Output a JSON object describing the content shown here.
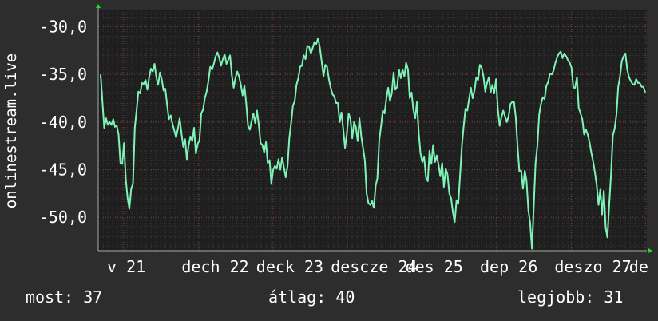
{
  "chart_data": {
    "type": "line",
    "ylabel": "onlinestream.live",
    "ylim": [
      -53.5,
      -28.2
    ],
    "y_ticks": [
      -30,
      -35,
      -40,
      -45,
      -50
    ],
    "y_tick_labels": [
      "-30,0",
      "-35,0",
      "-40,0",
      "-45,0",
      "-50,0"
    ],
    "x_tick_labels": [
      "v 21",
      "dech 22",
      "deck 23",
      "descze 24",
      "des 25",
      "dep 26",
      "deszo 27",
      "de"
    ],
    "grid": true,
    "colors": {
      "line": "#7ff3b7",
      "background": "#2d2d2d",
      "plot_bg": "#1e1e1e",
      "grid_minor": "#3a3a3a",
      "grid_major": "#7a3f3f",
      "axis_arrow": "#22dd22"
    },
    "series": [
      {
        "values": [
          -35.0,
          -37.9,
          -40.6,
          -39.6,
          -40.3,
          -40.0,
          -40.3,
          -39.7,
          -40.5,
          -40.4,
          -41.3,
          -44.3,
          -44.4,
          -42.2,
          -46.0,
          -48.0,
          -49.1,
          -47.0,
          -46.5,
          -40.6,
          -38.8,
          -36.8,
          -37.0,
          -35.9,
          -36.0,
          -35.6,
          -36.6,
          -35.3,
          -34.4,
          -34.7,
          -33.9,
          -35.3,
          -36.1,
          -34.8,
          -35.5,
          -36.7,
          -36.5,
          -38.2,
          -39.7,
          -39.3,
          -40.2,
          -40.9,
          -41.6,
          -40.7,
          -39.6,
          -41.2,
          -42.6,
          -41.8,
          -43.9,
          -42.4,
          -41.5,
          -42.0,
          -40.6,
          -43.3,
          -42.3,
          -41.9,
          -39.1,
          -38.7,
          -37.5,
          -36.8,
          -35.7,
          -34.2,
          -34.5,
          -33.9,
          -33.1,
          -32.7,
          -33.3,
          -34.1,
          -33.4,
          -32.9,
          -33.9,
          -33.5,
          -33.0,
          -35.1,
          -36.4,
          -35.4,
          -34.7,
          -35.2,
          -36.1,
          -37.2,
          -36.2,
          -38.0,
          -40.4,
          -40.8,
          -39.9,
          -39.1,
          -40.1,
          -38.8,
          -40.3,
          -42.2,
          -42.4,
          -43.2,
          -42.1,
          -44.3,
          -44.0,
          -46.5,
          -45.0,
          -44.6,
          -44.9,
          -43.9,
          -45.0,
          -43.7,
          -44.8,
          -45.8,
          -44.6,
          -41.7,
          -40.1,
          -38.3,
          -37.8,
          -36.1,
          -35.4,
          -34.2,
          -34.1,
          -33.0,
          -33.4,
          -32.0,
          -32.1,
          -32.8,
          -32.2,
          -31.6,
          -31.8,
          -31.2,
          -32.2,
          -33.7,
          -35.2,
          -34.0,
          -34.2,
          -35.5,
          -36.4,
          -37.1,
          -37.3,
          -38.0,
          -38.0,
          -40.0,
          -39.0,
          -40.8,
          -42.7,
          -41.2,
          -39.1,
          -39.7,
          -41.7,
          -40.0,
          -40.5,
          -42.0,
          -39.6,
          -41.5,
          -42.7,
          -44.0,
          -47.5,
          -48.5,
          -48.7,
          -48.3,
          -49.0,
          -46.7,
          -45.9,
          -41.9,
          -40.5,
          -38.8,
          -39.1,
          -37.5,
          -36.4,
          -37.8,
          -37.0,
          -34.8,
          -36.6,
          -36.3,
          -34.5,
          -35.4,
          -34.5,
          -35.2,
          -33.8,
          -34.5,
          -37.5,
          -36.9,
          -38.7,
          -39.6,
          -37.9,
          -41.2,
          -43.3,
          -44.2,
          -43.6,
          -45.8,
          -46.2,
          -43.0,
          -44.4,
          -42.4,
          -44.2,
          -43.5,
          -44.5,
          -45.7,
          -44.3,
          -46.8,
          -44.9,
          -45.5,
          -47.5,
          -48.0,
          -49.5,
          -50.5,
          -48.2,
          -48.6,
          -45.5,
          -42.5,
          -40.4,
          -38.6,
          -38.8,
          -37.6,
          -36.4,
          -37.5,
          -36.7,
          -35.3,
          -35.6,
          -34.0,
          -34.3,
          -35.2,
          -36.8,
          -35.9,
          -35.3,
          -36.9,
          -36.1,
          -37.0,
          -35.5,
          -38.6,
          -40.4,
          -39.5,
          -38.8,
          -39.4,
          -40.0,
          -39.4,
          -38.1,
          -37.9,
          -37.9,
          -39.5,
          -42.6,
          -45.2,
          -45.1,
          -47.0,
          -45.1,
          -46.2,
          -49.3,
          -50.6,
          -53.3,
          -48.8,
          -44.3,
          -42.4,
          -39.2,
          -38.1,
          -37.4,
          -37.6,
          -36.2,
          -35.8,
          -34.9,
          -35.0,
          -34.6,
          -33.8,
          -33.2,
          -32.8,
          -32.6,
          -33.3,
          -32.8,
          -33.1,
          -33.5,
          -33.8,
          -34.3,
          -36.4,
          -36.4,
          -35.3,
          -38.5,
          -39.1,
          -39.7,
          -41.3,
          -40.8,
          -41.3,
          -42.1,
          -43.2,
          -44.1,
          -45.3,
          -46.6,
          -48.7,
          -47.1,
          -49.7,
          -47.2,
          -51.1,
          -52.1,
          -48.5,
          -45.5,
          -41.4,
          -40.7,
          -39.2,
          -36.3,
          -35.2,
          -33.6,
          -33.1,
          -32.8,
          -34.5,
          -35.3,
          -35.7,
          -36.0,
          -36.1,
          -35.5,
          -35.9,
          -35.9,
          -36.3,
          -36.3,
          -36.9
        ]
      }
    ]
  },
  "footer": {
    "most": "most: 37",
    "avg": "átlag: 40",
    "best": "legjobb: 31"
  }
}
